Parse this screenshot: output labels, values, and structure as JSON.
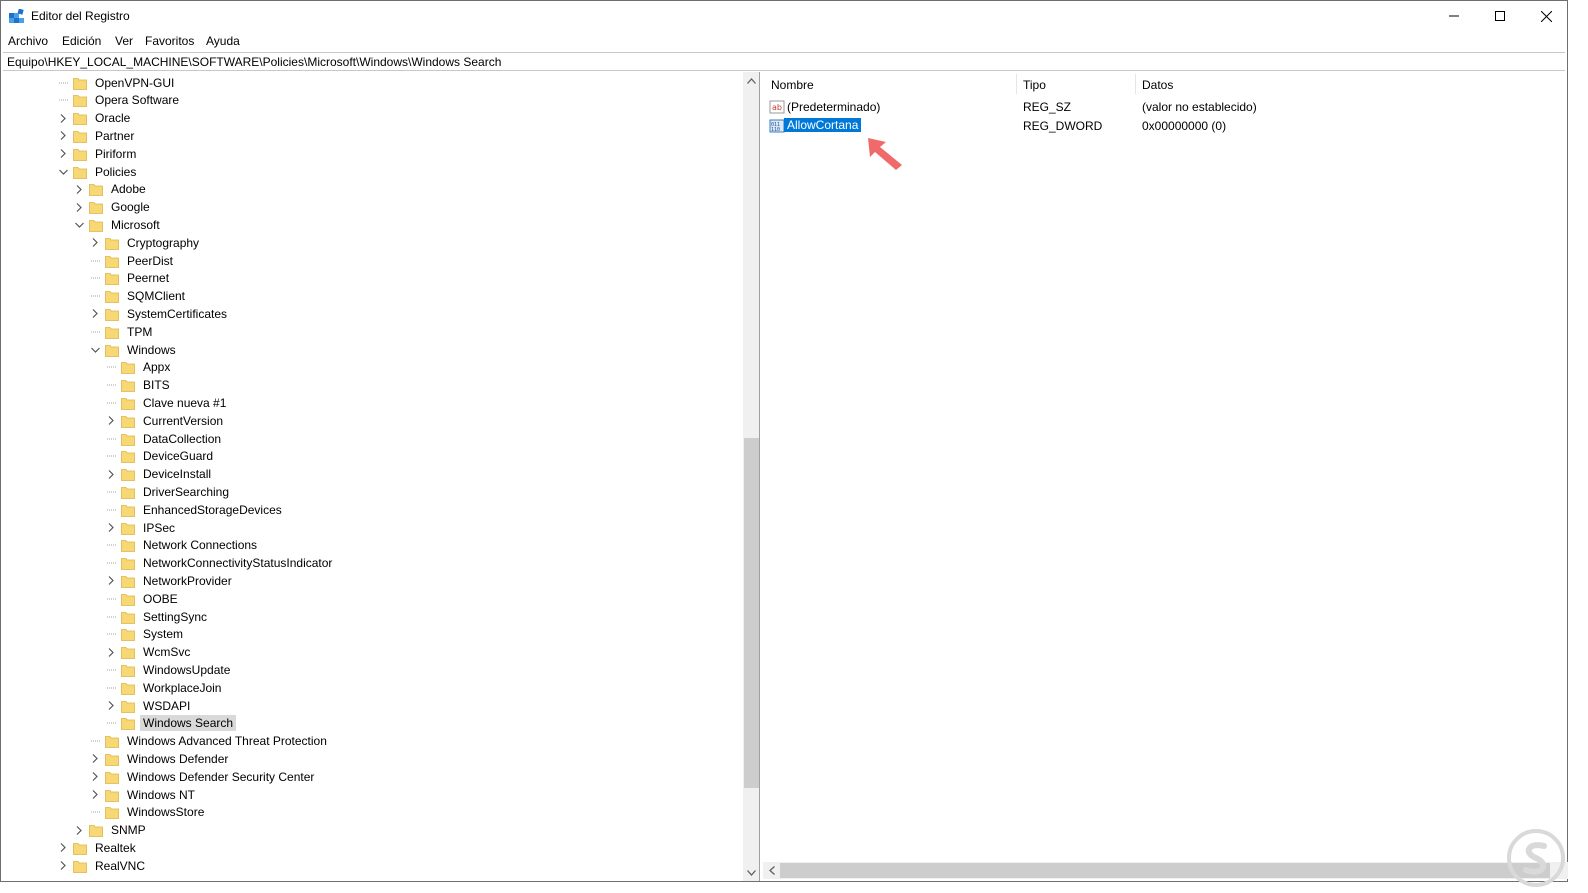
{
  "window": {
    "title": "Editor del Registro",
    "minimize_glyph": "—",
    "maximize_glyph": "☐",
    "close_glyph": "✕"
  },
  "menu": [
    "Archivo",
    "Edición",
    "Ver",
    "Favoritos",
    "Ayuda"
  ],
  "address": "Equipo\\HKEY_LOCAL_MACHINE\\SOFTWARE\\Policies\\Microsoft\\Windows\\Windows Search",
  "tree": [
    {
      "label": "OpenVPN-GUI",
      "level": 0,
      "expander": "none"
    },
    {
      "label": "Opera Software",
      "level": 0,
      "expander": "none"
    },
    {
      "label": "Oracle",
      "level": 0,
      "expander": "collapsed"
    },
    {
      "label": "Partner",
      "level": 0,
      "expander": "collapsed"
    },
    {
      "label": "Piriform",
      "level": 0,
      "expander": "collapsed"
    },
    {
      "label": "Policies",
      "level": 0,
      "expander": "expanded"
    },
    {
      "label": "Adobe",
      "level": 1,
      "expander": "collapsed"
    },
    {
      "label": "Google",
      "level": 1,
      "expander": "collapsed"
    },
    {
      "label": "Microsoft",
      "level": 1,
      "expander": "expanded"
    },
    {
      "label": "Cryptography",
      "level": 2,
      "expander": "collapsed"
    },
    {
      "label": "PeerDist",
      "level": 2,
      "expander": "none"
    },
    {
      "label": "Peernet",
      "level": 2,
      "expander": "none"
    },
    {
      "label": "SQMClient",
      "level": 2,
      "expander": "none"
    },
    {
      "label": "SystemCertificates",
      "level": 2,
      "expander": "collapsed"
    },
    {
      "label": "TPM",
      "level": 2,
      "expander": "none"
    },
    {
      "label": "Windows",
      "level": 2,
      "expander": "expanded"
    },
    {
      "label": "Appx",
      "level": 3,
      "expander": "none"
    },
    {
      "label": "BITS",
      "level": 3,
      "expander": "none"
    },
    {
      "label": "Clave nueva #1",
      "level": 3,
      "expander": "none"
    },
    {
      "label": "CurrentVersion",
      "level": 3,
      "expander": "collapsed"
    },
    {
      "label": "DataCollection",
      "level": 3,
      "expander": "none"
    },
    {
      "label": "DeviceGuard",
      "level": 3,
      "expander": "none"
    },
    {
      "label": "DeviceInstall",
      "level": 3,
      "expander": "collapsed"
    },
    {
      "label": "DriverSearching",
      "level": 3,
      "expander": "none"
    },
    {
      "label": "EnhancedStorageDevices",
      "level": 3,
      "expander": "none"
    },
    {
      "label": "IPSec",
      "level": 3,
      "expander": "collapsed"
    },
    {
      "label": "Network Connections",
      "level": 3,
      "expander": "none"
    },
    {
      "label": "NetworkConnectivityStatusIndicator",
      "level": 3,
      "expander": "none"
    },
    {
      "label": "NetworkProvider",
      "level": 3,
      "expander": "collapsed"
    },
    {
      "label": "OOBE",
      "level": 3,
      "expander": "none"
    },
    {
      "label": "SettingSync",
      "level": 3,
      "expander": "none"
    },
    {
      "label": "System",
      "level": 3,
      "expander": "none"
    },
    {
      "label": "WcmSvc",
      "level": 3,
      "expander": "collapsed"
    },
    {
      "label": "WindowsUpdate",
      "level": 3,
      "expander": "none"
    },
    {
      "label": "WorkplaceJoin",
      "level": 3,
      "expander": "none"
    },
    {
      "label": "WSDAPI",
      "level": 3,
      "expander": "collapsed"
    },
    {
      "label": "Windows Search",
      "level": 3,
      "expander": "none",
      "selected": true
    },
    {
      "label": "Windows Advanced Threat Protection",
      "level": 2,
      "expander": "none"
    },
    {
      "label": "Windows Defender",
      "level": 2,
      "expander": "collapsed"
    },
    {
      "label": "Windows Defender Security Center",
      "level": 2,
      "expander": "collapsed"
    },
    {
      "label": "Windows NT",
      "level": 2,
      "expander": "collapsed"
    },
    {
      "label": "WindowsStore",
      "level": 2,
      "expander": "none"
    },
    {
      "label": "SNMP",
      "level": 1,
      "expander": "collapsed"
    },
    {
      "label": "Realtek",
      "level": 0,
      "expander": "collapsed"
    },
    {
      "label": "RealVNC",
      "level": 0,
      "expander": "collapsed"
    }
  ],
  "list": {
    "headers": {
      "name": "Nombre",
      "type": "Tipo",
      "data": "Datos"
    },
    "rows": [
      {
        "name": "(Predeterminado)",
        "type": "REG_SZ",
        "data": "(valor no establecido)",
        "icon": "string-value-icon",
        "selected": false
      },
      {
        "name": "AllowCortana",
        "type": "REG_DWORD",
        "data": "0x00000000 (0)",
        "icon": "dword-value-icon",
        "selected": true
      }
    ]
  },
  "colors": {
    "folder": "#f8d775",
    "selection_blue": "#0078d7",
    "arrow": "#f06a6a"
  }
}
